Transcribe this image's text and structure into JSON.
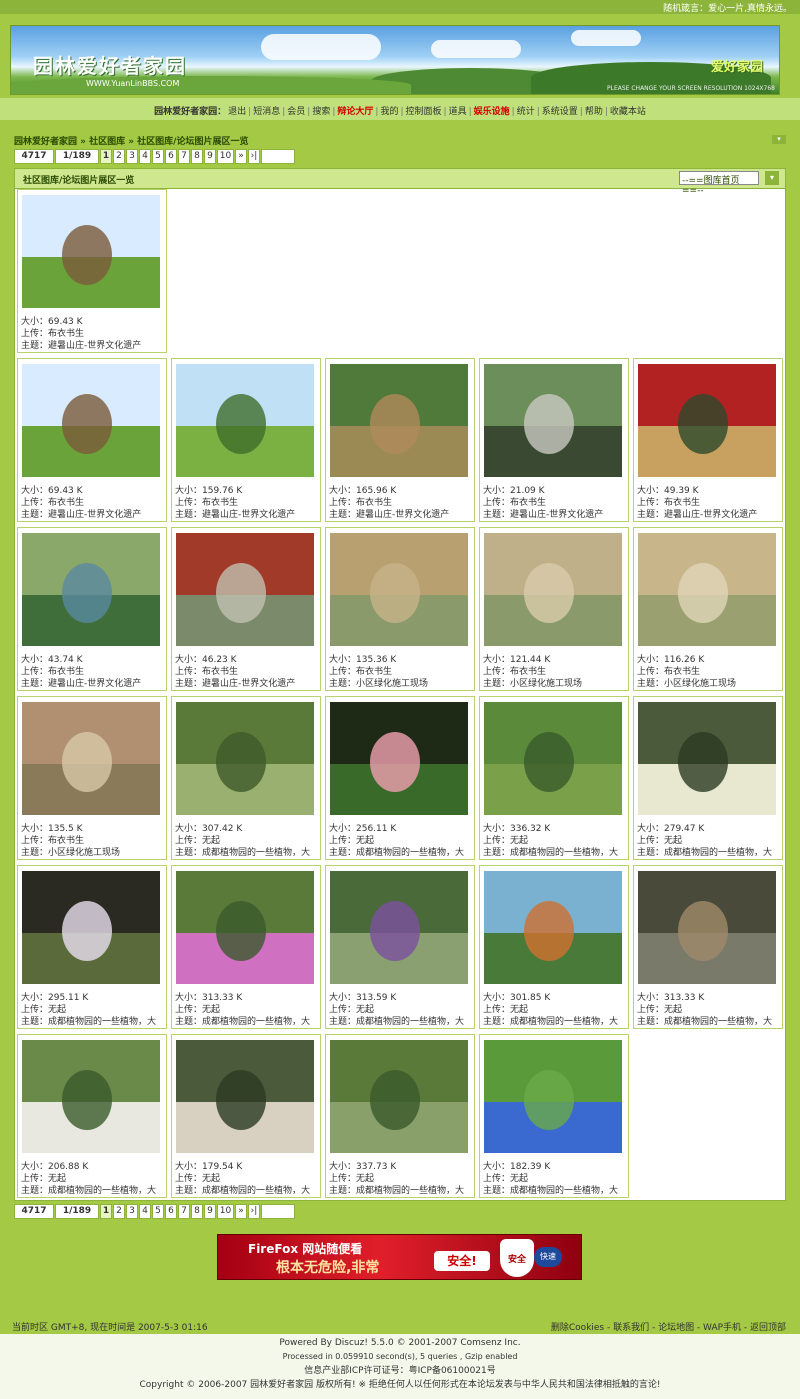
{
  "topbar": {
    "text": "随机箴言：爱心一片,真情永远。"
  },
  "banner": {
    "title": "园林爱好者家园",
    "subtitle": "WWW.YuanLinBBS.COM",
    "brand": "爱好家园",
    "resolution": "PLEASE CHANGE YOUR SCREEN RESOLUTION 1024X768"
  },
  "nav": {
    "items": [
      {
        "label": "园林爱好者家园："
      },
      {
        "label": "退出"
      },
      {
        "label": "短消息"
      },
      {
        "label": "会员"
      },
      {
        "label": "搜索"
      },
      {
        "label": "辩论大厅"
      },
      {
        "label": "我的"
      },
      {
        "label": "控制面板"
      },
      {
        "label": "道具"
      },
      {
        "label": "娱乐设施"
      },
      {
        "label": "统计"
      },
      {
        "label": "系统设置"
      },
      {
        "label": "帮助"
      },
      {
        "label": "收藏本站"
      }
    ]
  },
  "breadcrumb": "园林爱好者家园 » 社区图库 » 社区图库/论坛图片展区一览",
  "pager": {
    "total": "4717",
    "pages": "1/189",
    "numbers": [
      "1",
      "2",
      "3",
      "4",
      "5",
      "6",
      "7",
      "8",
      "9",
      "10",
      "»",
      "›|"
    ]
  },
  "gallery": {
    "title": "社区图库/论坛图片展区一览",
    "select": "--==图库首页==--"
  },
  "labels": {
    "size": "大小：",
    "uploader": "上传：",
    "subject": "主题："
  },
  "items": [
    {
      "size": "69.43 K",
      "uploader": "布衣书生",
      "subject": "避暑山庄-世界文化遗产"
    },
    {
      "size": "69.43 K",
      "uploader": "布衣书生",
      "subject": "避暑山庄-世界文化遗产"
    },
    {
      "size": "159.76 K",
      "uploader": "布衣书生",
      "subject": "避暑山庄-世界文化遗产"
    },
    {
      "size": "165.96 K",
      "uploader": "布衣书生",
      "subject": "避暑山庄-世界文化遗产"
    },
    {
      "size": "21.09 K",
      "uploader": "布衣书生",
      "subject": "避暑山庄-世界文化遗产"
    },
    {
      "size": "49.39 K",
      "uploader": "布衣书生",
      "subject": "避暑山庄-世界文化遗产"
    },
    {
      "size": "43.74 K",
      "uploader": "布衣书生",
      "subject": "避暑山庄-世界文化遗产"
    },
    {
      "size": "46.23 K",
      "uploader": "布衣书生",
      "subject": "避暑山庄-世界文化遗产"
    },
    {
      "size": "135.36 K",
      "uploader": "布衣书生",
      "subject": "小区绿化施工现场"
    },
    {
      "size": "121.44 K",
      "uploader": "布衣书生",
      "subject": "小区绿化施工现场"
    },
    {
      "size": "116.26 K",
      "uploader": "布衣书生",
      "subject": "小区绿化施工现场"
    },
    {
      "size": "135.5 K",
      "uploader": "布衣书生",
      "subject": "小区绿化施工现场"
    },
    {
      "size": "307.42 K",
      "uploader": "无起",
      "subject": "成都植物园的一些植物，大"
    },
    {
      "size": "256.11 K",
      "uploader": "无起",
      "subject": "成都植物园的一些植物，大"
    },
    {
      "size": "336.32 K",
      "uploader": "无起",
      "subject": "成都植物园的一些植物，大"
    },
    {
      "size": "279.47 K",
      "uploader": "无起",
      "subject": "成都植物园的一些植物，大"
    },
    {
      "size": "295.11 K",
      "uploader": "无起",
      "subject": "成都植物园的一些植物，大"
    },
    {
      "size": "313.33 K",
      "uploader": "无起",
      "subject": "成都植物园的一些植物，大"
    },
    {
      "size": "313.59 K",
      "uploader": "无起",
      "subject": "成都植物园的一些植物，大"
    },
    {
      "size": "301.85 K",
      "uploader": "无起",
      "subject": "成都植物园的一些植物，大"
    },
    {
      "size": "313.33 K",
      "uploader": "无起",
      "subject": "成都植物园的一些植物，大"
    },
    {
      "size": "206.88 K",
      "uploader": "无起",
      "subject": "成都植物园的一些植物，大"
    },
    {
      "size": "179.54 K",
      "uploader": "无起",
      "subject": "成都植物园的一些植物，大"
    },
    {
      "size": "337.73 K",
      "uploader": "无起",
      "subject": "成都植物园的一些植物，大"
    },
    {
      "size": "182.39 K",
      "uploader": "无起",
      "subject": "成都植物园的一些植物，大"
    }
  ],
  "ad": {
    "line1": "FireFox 网站随便看",
    "line2": "根本无危险,非常",
    "safe": "安全!",
    "shield": "安全",
    "fast": "快速"
  },
  "footer": {
    "time": "当前时区  GMT+8, 现在时间是  2007-5-3 01:16",
    "links": "删除Cookies - 联系我们 - 论坛地图 - WAP手机 - 返回顶部",
    "powered": "Powered By Discuz! 5.5.0 © 2001-2007 Comsenz Inc.",
    "processed": "Processed in 0.059910 second(s), 5 queries , Gzip enabled",
    "icp": "信息产业部ICP许可证号：粤ICP备06100021号",
    "copyright": "Copyright © 2006-2007 园林爱好者家园 版权所有! ※ 拒绝任何人以任何形式在本论坛发表与中华人民共和国法律相抵触的言论!"
  }
}
